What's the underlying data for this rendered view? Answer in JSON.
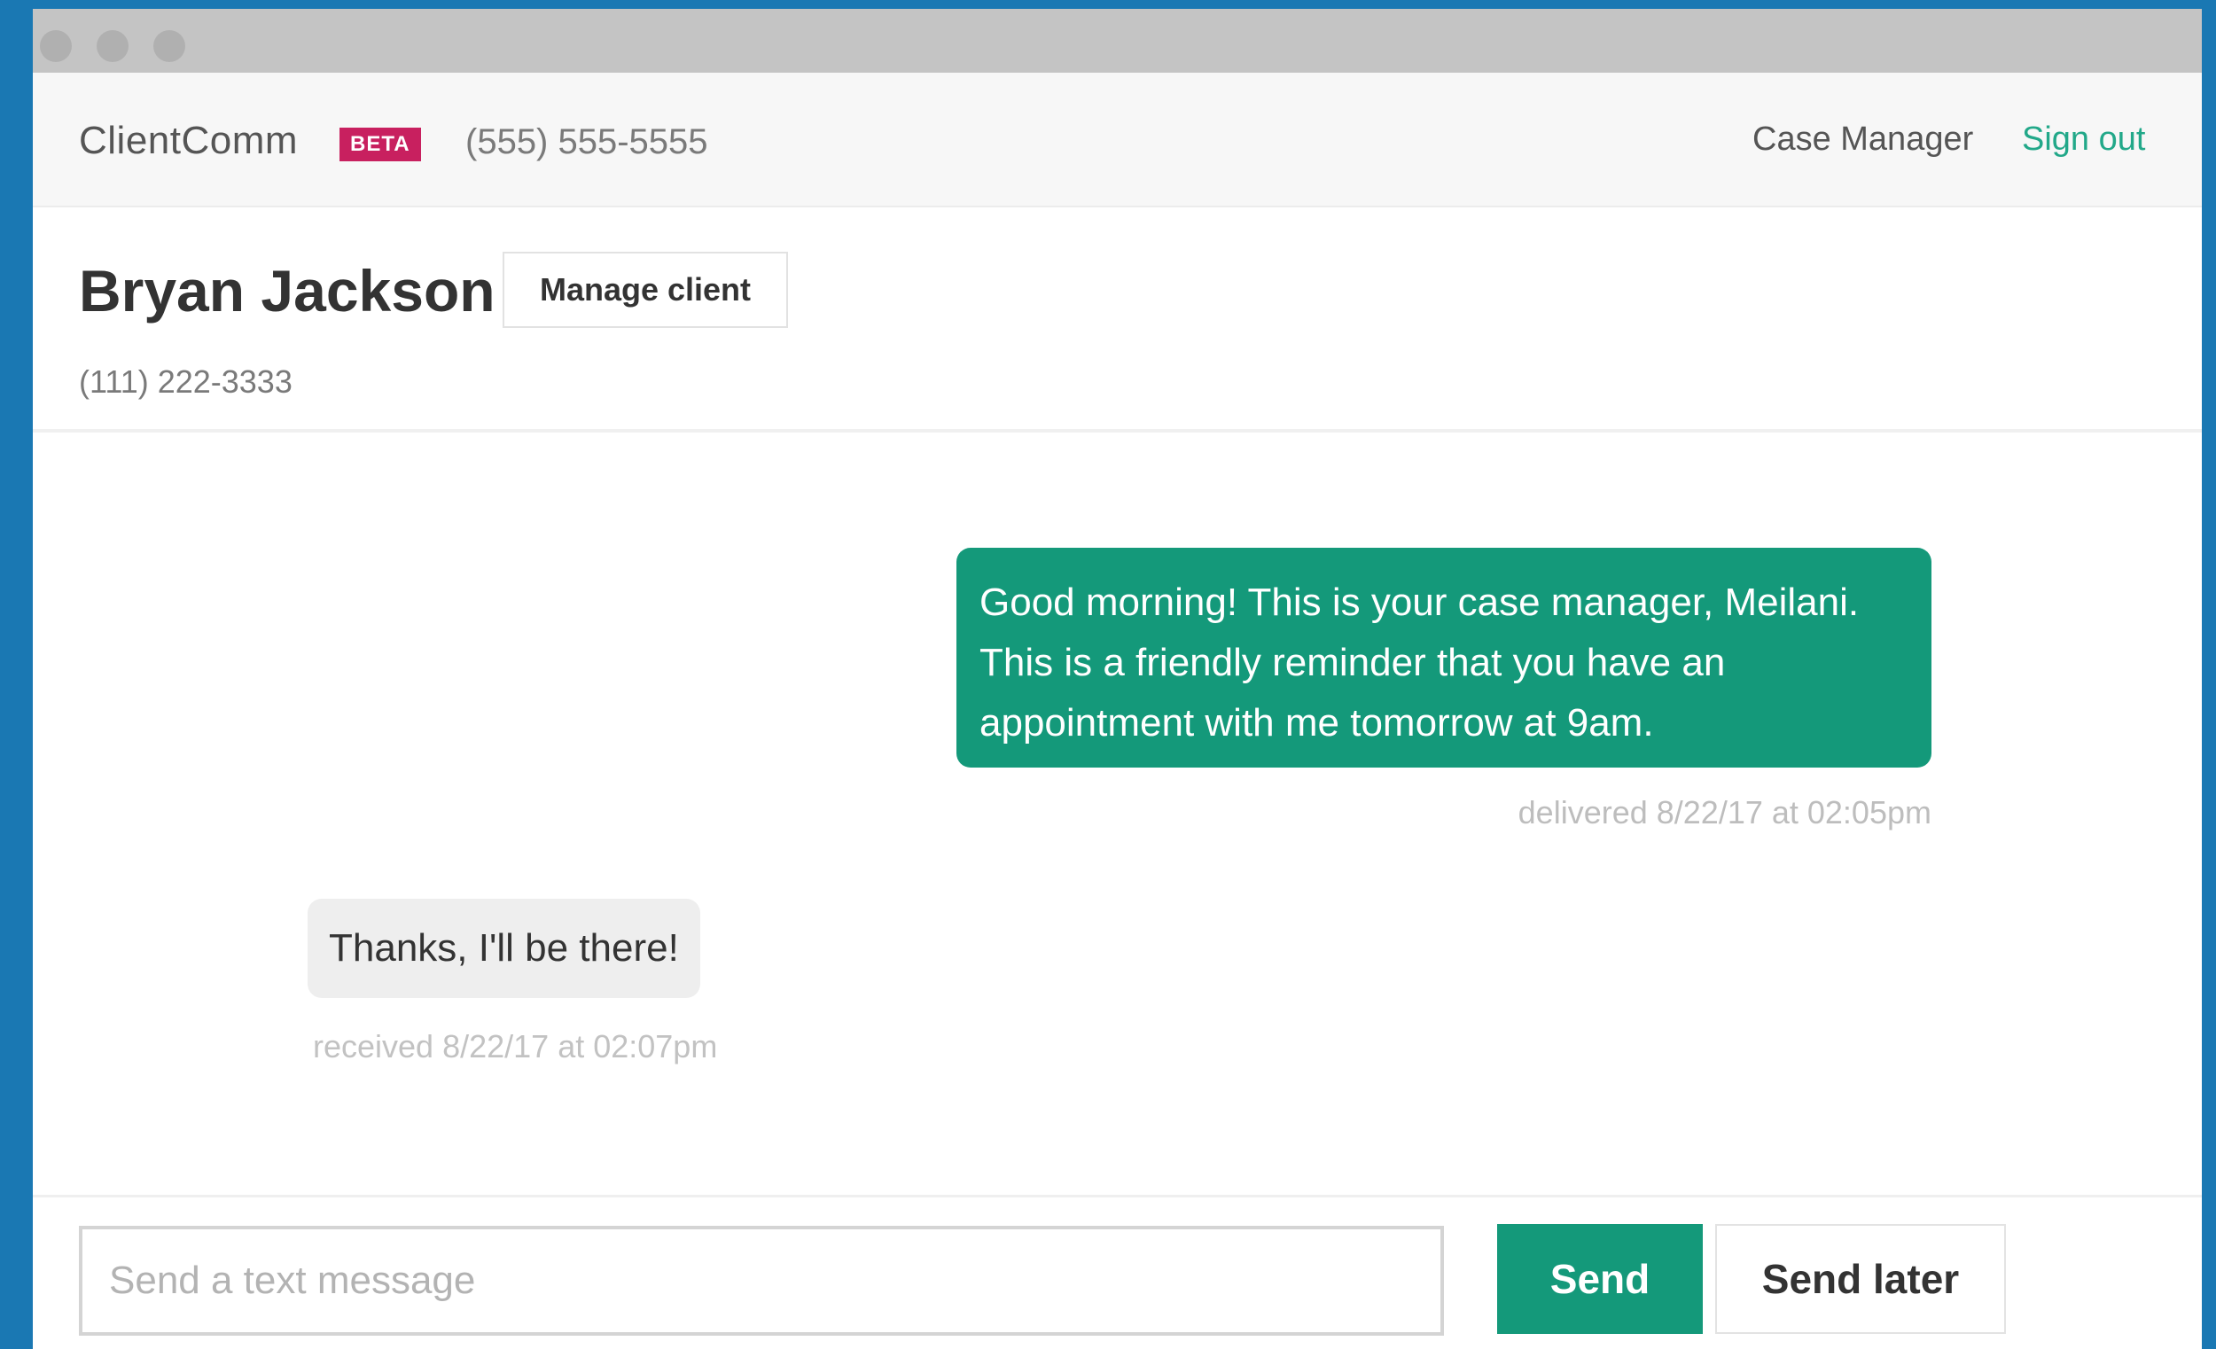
{
  "header": {
    "app_name": "ClientComm",
    "badge": "BETA",
    "org_phone": "(555) 555-5555",
    "user_role": "Case Manager",
    "sign_out": "Sign out"
  },
  "client": {
    "name": "Bryan Jackson",
    "manage_label": "Manage client",
    "phone": "(111) 222-3333"
  },
  "messages": [
    {
      "direction": "outgoing",
      "text": "Good morning! This is your case manager, Meilani. This is a friendly reminder that you have an appointment with me tomorrow at 9am.",
      "status": "delivered 8/22/17 at 02:05pm"
    },
    {
      "direction": "incoming",
      "text": "Thanks, I'll be there!",
      "status": "received 8/22/17 at 02:07pm"
    }
  ],
  "composer": {
    "placeholder": "Send a text message",
    "value": "",
    "send_label": "Send",
    "send_later_label": "Send later"
  },
  "colors": {
    "accent": "#14997a",
    "badge": "#c8205f",
    "link": "#22a889",
    "desktop": "#1a78b3"
  }
}
